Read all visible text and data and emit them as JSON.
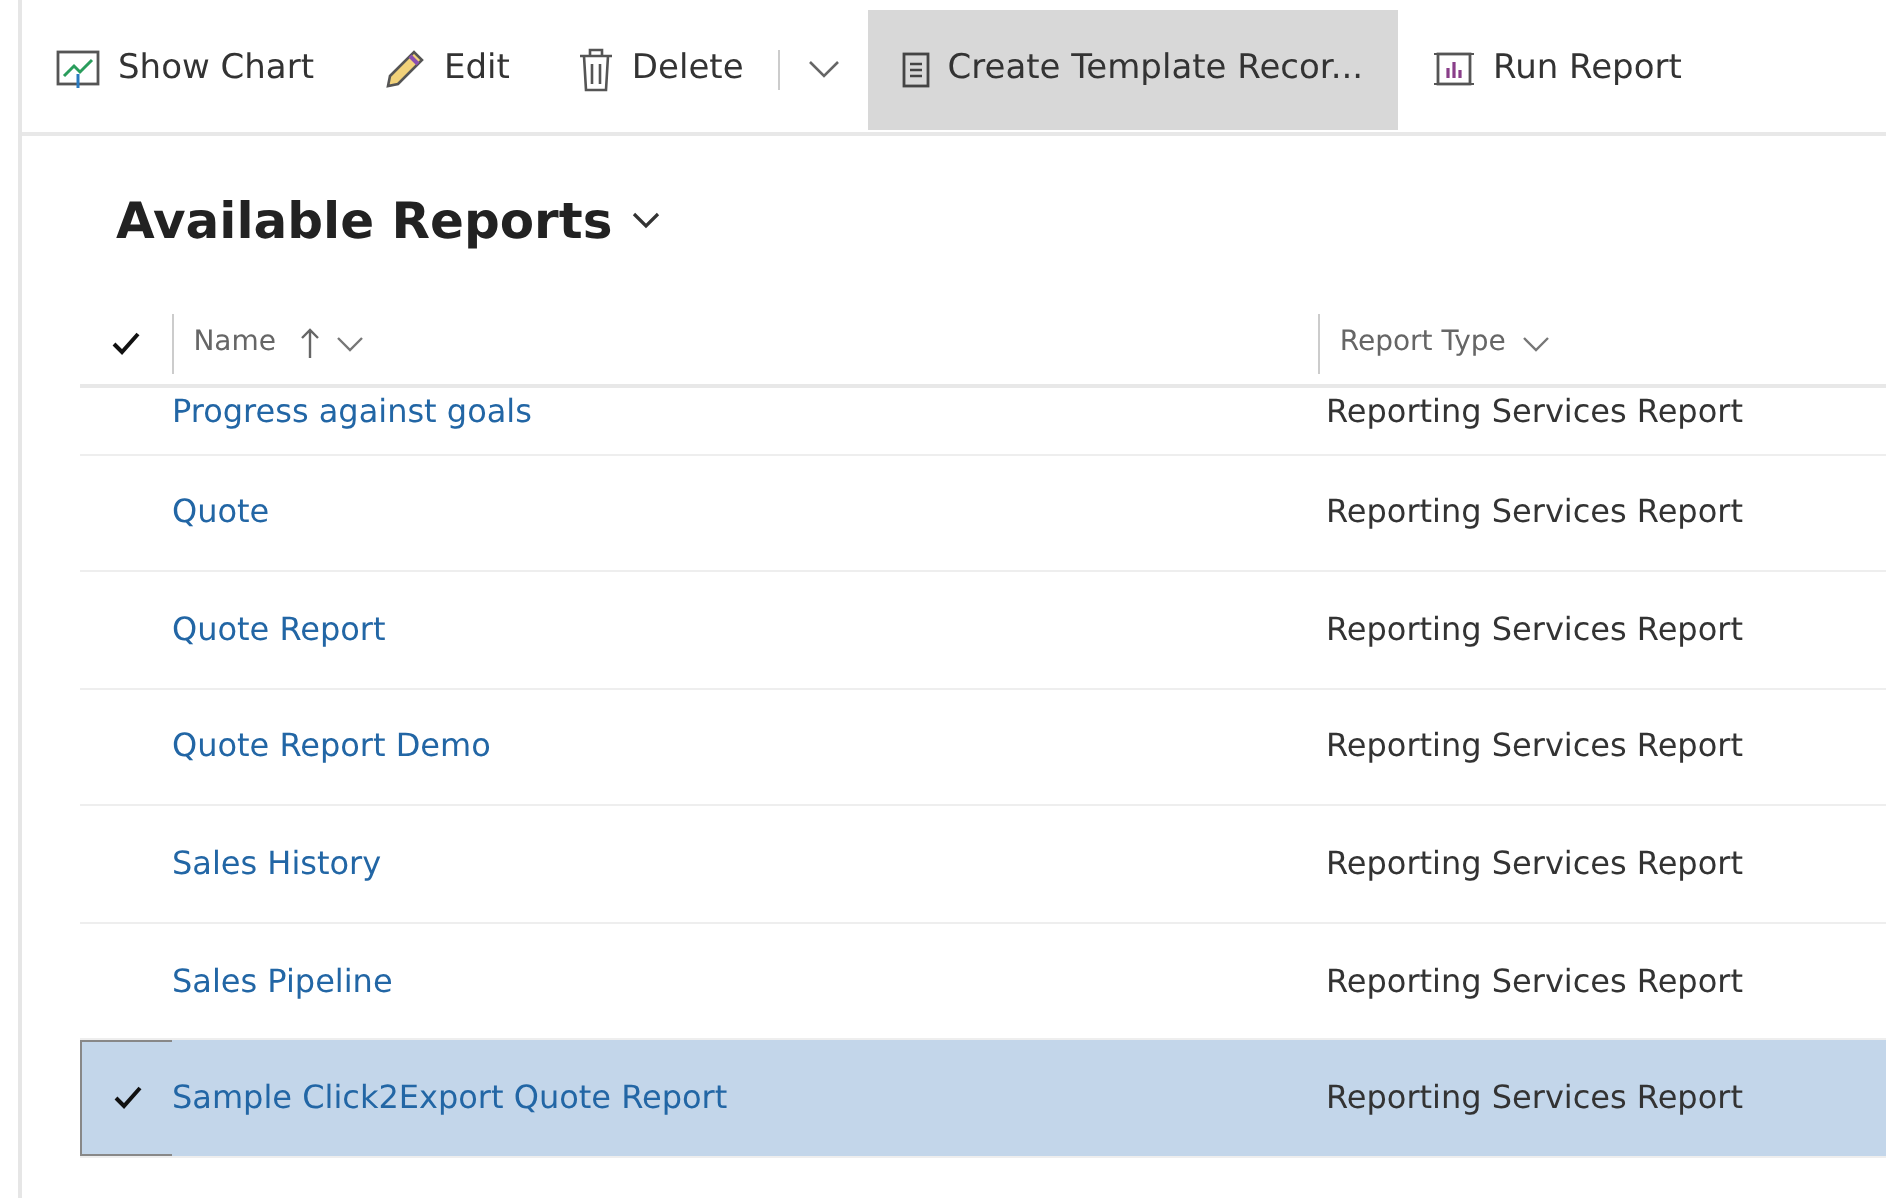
{
  "toolbar": [
    {
      "kind": "chart",
      "label": "Show Chart",
      "highlighted": false
    },
    {
      "kind": "pencil",
      "label": "Edit",
      "highlighted": false
    },
    {
      "kind": "trash",
      "label": "Delete",
      "highlighted": false
    },
    {
      "kind": "more",
      "highlighted": false
    },
    {
      "kind": "document",
      "label": "Create Template Recor...",
      "highlighted": true
    },
    {
      "kind": "report",
      "label": "Run Report",
      "highlighted": false
    }
  ],
  "view_title": "Available Reports",
  "table": {
    "columns": [
      {
        "label": "Name",
        "sorted": true
      },
      {
        "label": "Report Type",
        "sorted": false
      }
    ],
    "rows": [
      {
        "name": "Progress against goals",
        "type": "Reporting Services Report",
        "selected": false
      },
      {
        "name": "Quote",
        "type": "Reporting Services Report",
        "selected": false
      },
      {
        "name": "Quote Report",
        "type": "Reporting Services Report",
        "selected": false
      },
      {
        "name": "Quote Report Demo",
        "type": "Reporting Services Report",
        "selected": false
      },
      {
        "name": "Sales History",
        "type": "Reporting Services Report",
        "selected": false
      },
      {
        "name": "Sales Pipeline",
        "type": "Reporting Services Report",
        "selected": false
      },
      {
        "name": "Sample Click2Export Quote Report",
        "type": "Reporting Services Report",
        "selected": true
      }
    ]
  }
}
